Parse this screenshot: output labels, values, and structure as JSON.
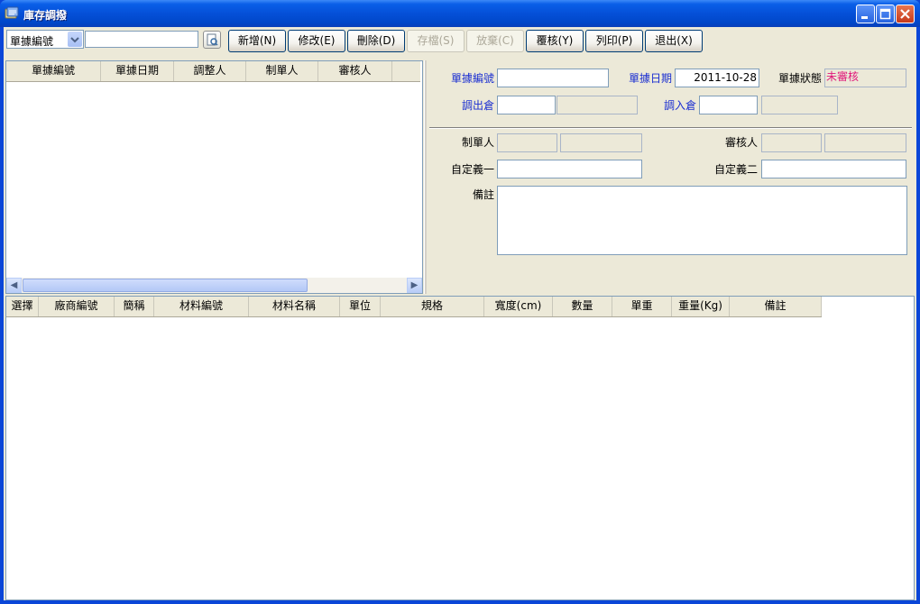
{
  "window": {
    "title": "庫存調撥"
  },
  "toolbar": {
    "search_field": "單據編號",
    "search_value": "",
    "buttons": [
      {
        "label": "新增(N)",
        "enabled": true
      },
      {
        "label": "修改(E)",
        "enabled": true
      },
      {
        "label": "刪除(D)",
        "enabled": true
      },
      {
        "label": "存檔(S)",
        "enabled": false
      },
      {
        "label": "放棄(C)",
        "enabled": false
      },
      {
        "label": "覆核(Y)",
        "enabled": true
      },
      {
        "label": "列印(P)",
        "enabled": true
      },
      {
        "label": "退出(X)",
        "enabled": true
      }
    ]
  },
  "list": {
    "columns": [
      "單據編號",
      "單據日期",
      "調整人",
      "制單人",
      "審核人"
    ]
  },
  "form": {
    "doc_no_label": "單據編號",
    "doc_no_value": "",
    "doc_date_label": "單據日期",
    "doc_date_value": "2011-10-28",
    "status_label": "單據狀態",
    "status_value": "未審核",
    "status_color": "#e0187a",
    "out_wh_label": "調出倉",
    "in_wh_label": "調入倉",
    "creator_label": "制單人",
    "reviewer_label": "審核人",
    "custom1_label": "自定義一",
    "custom2_label": "自定義二",
    "remark_label": "備註"
  },
  "grid": {
    "columns": [
      "選擇",
      "廠商編號",
      "簡稱",
      "材料編號",
      "材料名稱",
      "單位",
      "規格",
      "寬度(cm)",
      "數量",
      "單重",
      "重量(Kg)",
      "備註"
    ]
  }
}
